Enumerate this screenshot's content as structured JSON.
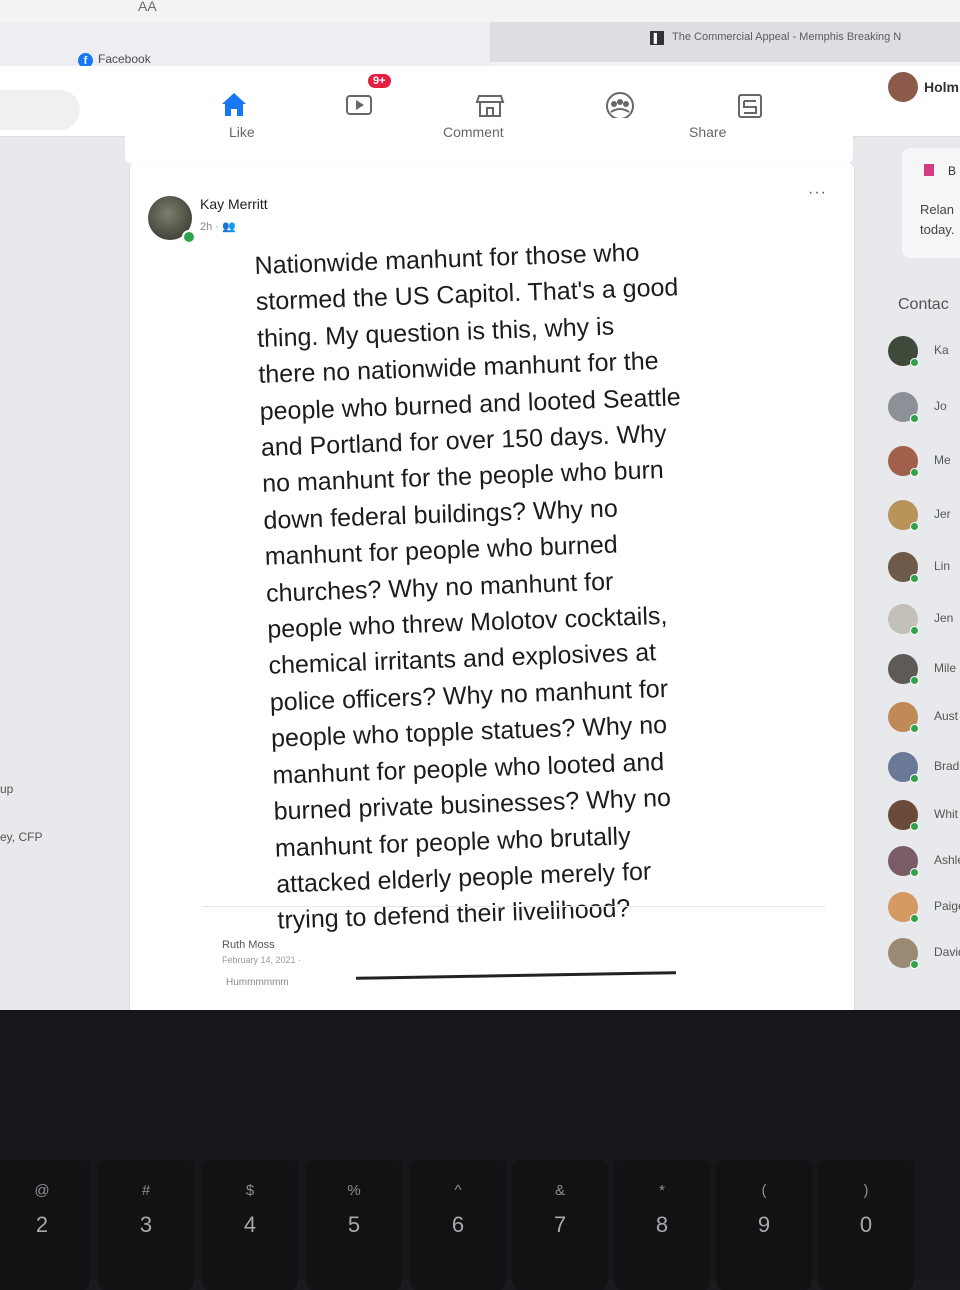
{
  "browser": {
    "text_size_button": "AA",
    "tab_facebook": "Facebook",
    "tab_commercial_appeal": "The Commercial Appeal - Memphis Breaking N"
  },
  "navbar": {
    "notification_badge": "9+",
    "profile_name": "Holm"
  },
  "previous_post_actions": {
    "like": "Like",
    "comment": "Comment",
    "share": "Share"
  },
  "left_sidebar": {
    "fragment_1": "up",
    "fragment_2": "ey, CFP"
  },
  "post": {
    "author": "Kay Merritt",
    "time": "2h ·",
    "more_options": "···",
    "body_lines": [
      "Nationwide manhunt for those who",
      "stormed the US Capitol. That's a good",
      "thing. My question is this, why is",
      "there no nationwide manhunt for the",
      "people who burned and looted Seattle",
      "and Portland for over 150 days. Why",
      "no manhunt for the people who burn",
      "down federal buildings? Why no",
      "manhunt for people who burned",
      "churches? Why no manhunt for",
      "people who threw Molotov cocktails,",
      "chemical irritants and explosives at",
      "police officers? Why no manhunt for",
      "people who topple statues? Why no",
      "manhunt for people who looted and",
      "burned private businesses? Why no",
      "manhunt for people who brutally",
      "attacked elderly people merely for",
      "trying to defend their livelihood?"
    ]
  },
  "comment": {
    "name": "Ruth Moss",
    "date": "February 14, 2021 ·",
    "text": "Hummmmmm"
  },
  "right_sidebar": {
    "birthday_label": "B",
    "birthday_line1": "Relan",
    "birthday_line2": "today.",
    "contacts_heading": "Contac",
    "contacts": [
      "Ka",
      "Jo",
      "Me",
      "Jer",
      "Lin",
      "Jen",
      "Mile",
      "Aust",
      "Brad",
      "Whit",
      "Ashle",
      "Paige",
      "David"
    ]
  },
  "keyboard": {
    "keys": [
      {
        "sym": "@",
        "num": "2"
      },
      {
        "sym": "#",
        "num": "3"
      },
      {
        "sym": "$",
        "num": "4"
      },
      {
        "sym": "%",
        "num": "5"
      },
      {
        "sym": "^",
        "num": "6"
      },
      {
        "sym": "&",
        "num": "7"
      },
      {
        "sym": "*",
        "num": "8"
      },
      {
        "sym": "(",
        "num": "9"
      },
      {
        "sym": ")",
        "num": "0"
      }
    ]
  },
  "colors": {
    "facebook_blue": "#1877f2",
    "badge_red": "#e41e3f",
    "online_green": "#31a24c"
  }
}
